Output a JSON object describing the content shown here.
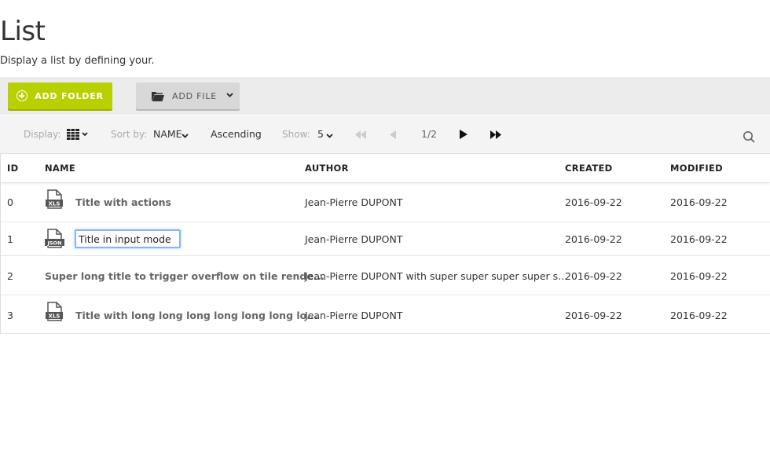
{
  "page": {
    "title": "List",
    "subtitle": "Display a list by defining your."
  },
  "actions": {
    "add_folder_label": "ADD FOLDER",
    "add_file_label": "ADD FILE"
  },
  "toolbar": {
    "display_label": "Display:",
    "sortby_label": "Sort by:",
    "sort_field": "NAME",
    "sort_order": "Ascending",
    "show_label": "Show:",
    "show_value": "5",
    "pagination": "1/2"
  },
  "table": {
    "columns": [
      "ID",
      "NAME",
      "AUTHOR",
      "CREATED",
      "MODIFIED"
    ],
    "rows": [
      {
        "id": "0",
        "icon": "xls-file-icon",
        "title": "Title with actions",
        "author": "Jean-Pierre DUPONT",
        "created": "2016-09-22",
        "modified": "2016-09-22"
      },
      {
        "id": "1",
        "icon": "json-file-icon",
        "title": "Title in input mode",
        "author": "Jean-Pierre DUPONT",
        "created": "2016-09-22",
        "modified": "2016-09-22"
      },
      {
        "id": "2",
        "icon": "",
        "title": "Super long title to trigger overflow on tile rende...",
        "author": "Jean-Pierre DUPONT with super super super super s...",
        "created": "2016-09-22",
        "modified": "2016-09-22"
      },
      {
        "id": "3",
        "icon": "xls-file-icon",
        "title": "Title with long long long long long long lo...",
        "author": "Jean-Pierre DUPONT",
        "created": "2016-09-22",
        "modified": "2016-09-22"
      }
    ]
  },
  "colors": {
    "accent": "#b9d000",
    "input_focus": "#86b6f5"
  }
}
